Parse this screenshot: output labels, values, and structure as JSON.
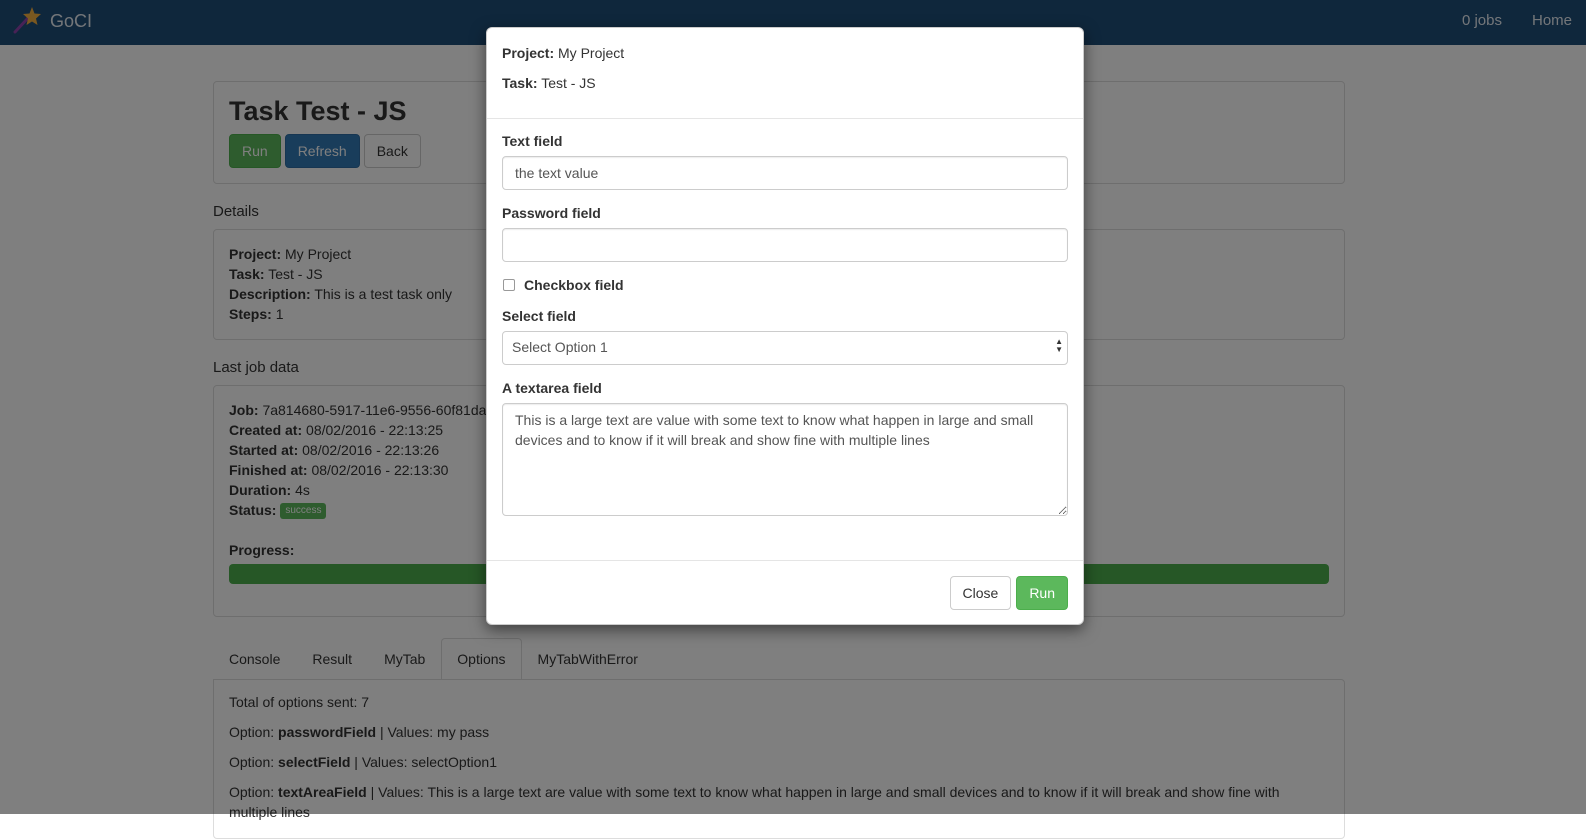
{
  "navbar": {
    "brand": "GoCI",
    "jobs_link": "0 jobs",
    "home_link": "Home"
  },
  "task_header": {
    "title": "Task Test - JS",
    "run_label": "Run",
    "refresh_label": "Refresh",
    "back_label": "Back"
  },
  "details": {
    "section_label": "Details",
    "project_label": "Project:",
    "project_value": "My Project",
    "task_label": "Task:",
    "task_value": "Test - JS",
    "description_label": "Description:",
    "description_value": "This is a test task only",
    "steps_label": "Steps:",
    "steps_value": "1"
  },
  "last_job": {
    "section_label": "Last job data",
    "job_label": "Job:",
    "job_value": "7a814680-5917-11e6-9556-60f81da",
    "created_label": "Created at:",
    "created_value": "08/02/2016 - 22:13:25",
    "started_label": "Started at:",
    "started_value": "08/02/2016 - 22:13:26",
    "finished_label": "Finished at:",
    "finished_value": "08/02/2016 - 22:13:30",
    "duration_label": "Duration:",
    "duration_value": "4s",
    "status_label": "Status:",
    "status_value": "success",
    "progress_label": "Progress:",
    "progress_value": 1.0
  },
  "tabs": [
    {
      "label": "Console"
    },
    {
      "label": "Result"
    },
    {
      "label": "MyTab"
    },
    {
      "label": "Options"
    },
    {
      "label": "MyTabWithError"
    }
  ],
  "options_tab": {
    "total": "Total of options sent: 7",
    "option_prefix": "Option:",
    "values_prefix": "| Values:",
    "rows": [
      {
        "name": "passwordField",
        "value": "my pass"
      },
      {
        "name": "selectField",
        "value": "selectOption1"
      },
      {
        "name": "textAreaField",
        "value": "This is a large text are value with some text to know what happen in large and small devices and to know if it will break and show fine with multiple lines"
      }
    ]
  },
  "modal": {
    "project_label": "Project:",
    "project_value": "My Project",
    "task_label": "Task:",
    "task_value": "Test - JS",
    "text_field_label": "Text field",
    "text_field_value": "the text value",
    "password_field_label": "Password field",
    "password_field_value": "",
    "checkbox_label": "Checkbox field",
    "select_label": "Select field",
    "select_value": "Select Option 1",
    "textarea_label": "A textarea field",
    "textarea_value": "This is a large text are value with some text to know what happen in large and small devices and to know if it will break and show fine with multiple lines",
    "close_label": "Close",
    "run_label": "Run"
  },
  "colors": {
    "navbar": "#1f4e79",
    "success": "#5cb85c",
    "primary": "#337ab7"
  },
  "icons": {
    "brand": "magic-wand-star-icon"
  }
}
